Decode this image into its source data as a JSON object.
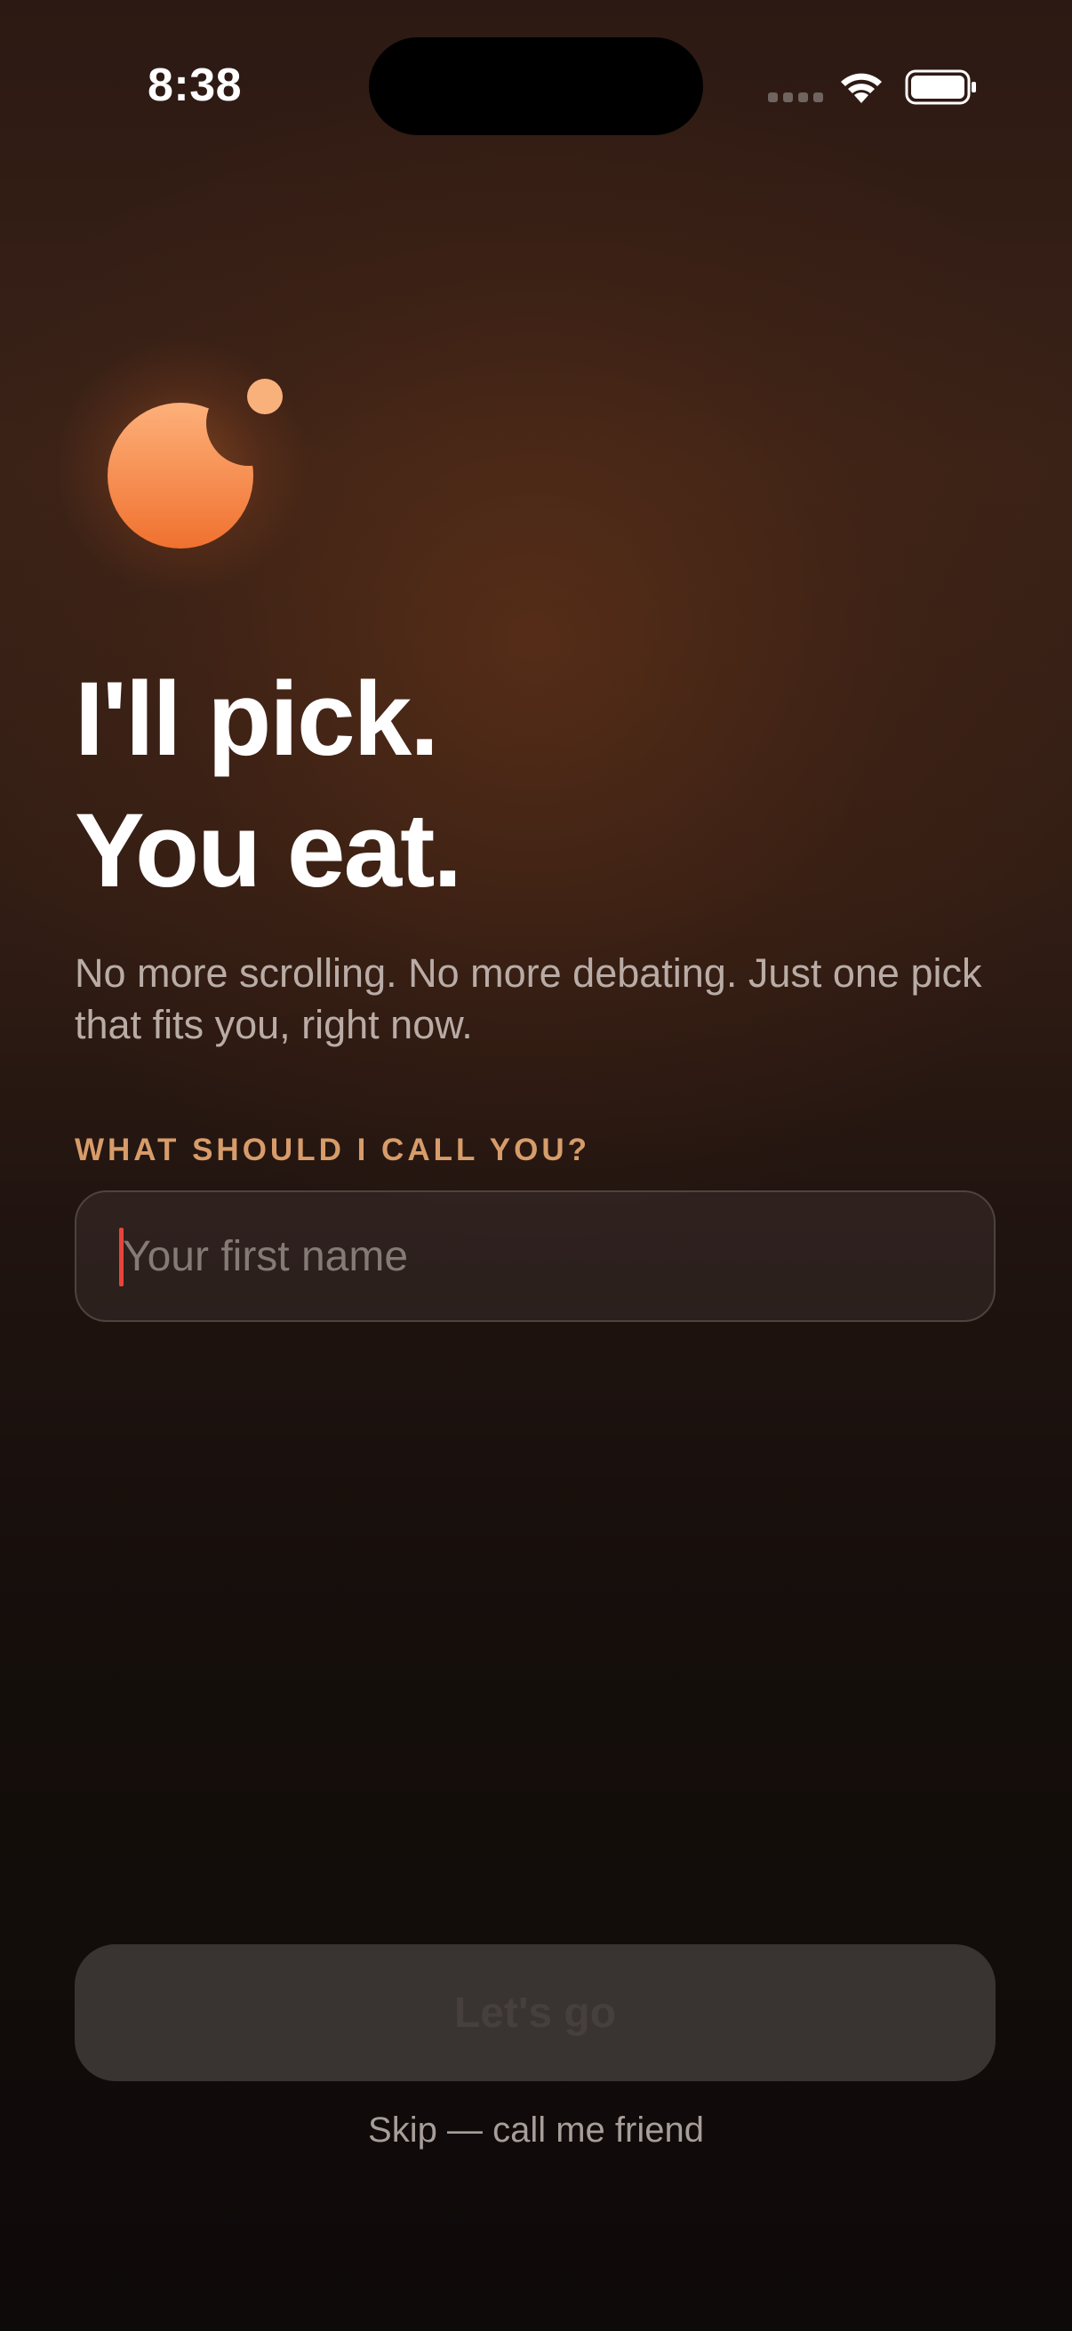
{
  "status_bar": {
    "time": "8:38"
  },
  "icons": {
    "wifi": "wifi-icon",
    "battery": "battery-icon",
    "signal": "cellular-signal-icon",
    "logo": "moon-orb-logo-icon"
  },
  "headline": {
    "line1": "I'll pick.",
    "line2": "You eat."
  },
  "subtitle": "No more scrolling. No more debating. Just one pick that fits you, right now.",
  "name_field": {
    "label": "WHAT SHOULD I CALL YOU?",
    "placeholder": "Your first name",
    "value": ""
  },
  "primary_button": {
    "label": "Let's go",
    "disabled": true
  },
  "skip_link": "Skip — call me friend",
  "colors": {
    "accent": "#f07a35",
    "label": "#d79c6a",
    "caret": "#e8443a"
  }
}
